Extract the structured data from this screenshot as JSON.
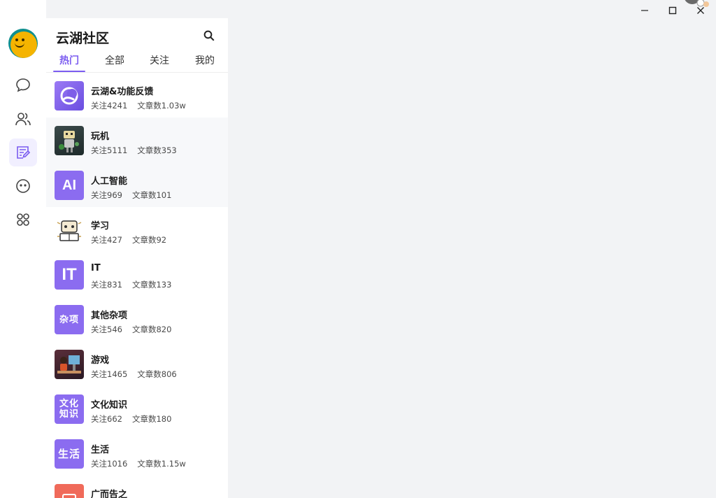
{
  "rail": {
    "avatar": "user-avatar",
    "items": [
      {
        "name": "chat-icon"
      },
      {
        "name": "contacts-icon"
      },
      {
        "name": "community-icon"
      },
      {
        "name": "more-icon"
      },
      {
        "name": "apps-icon"
      }
    ],
    "active_index": 2
  },
  "panel": {
    "title": "云湖社区",
    "tabs": [
      {
        "label": "热门"
      },
      {
        "label": "全部"
      },
      {
        "label": "关注"
      },
      {
        "label": "我的"
      }
    ],
    "active_tab": 0
  },
  "communities": [
    {
      "name": "云湖&功能反馈",
      "follow": "关注4241",
      "articles": "文章数1.03w",
      "icon": "cloud-lake-logo"
    },
    {
      "name": "玩机",
      "follow": "关注5111",
      "articles": "文章数353",
      "icon": "robot-image"
    },
    {
      "name": "人工智能",
      "follow": "关注969",
      "articles": "文章数101",
      "icon_text": "AI"
    },
    {
      "name": "学习",
      "follow": "关注427",
      "articles": "文章数92",
      "icon": "study-robot-image"
    },
    {
      "name": "IT",
      "follow": "关注831",
      "articles": "文章数133",
      "icon_text": "IT"
    },
    {
      "name": "其他杂项",
      "follow": "关注546",
      "articles": "文章数820",
      "icon_text": "杂项"
    },
    {
      "name": "游戏",
      "follow": "关注1465",
      "articles": "文章数806",
      "icon": "gamer-image"
    },
    {
      "name": "文化知识",
      "follow": "关注662",
      "articles": "文章数180",
      "icon_text": "文化知识"
    },
    {
      "name": "生活",
      "follow": "关注1016",
      "articles": "文章数1.15w",
      "icon_text": "生活"
    },
    {
      "name": "广而告之",
      "follow": "",
      "articles": "",
      "icon": "ad-icon"
    }
  ],
  "colors": {
    "accent": "#7b5cf0",
    "thumb_purple": "#8b6cf0",
    "background": "#f2f3f5"
  }
}
